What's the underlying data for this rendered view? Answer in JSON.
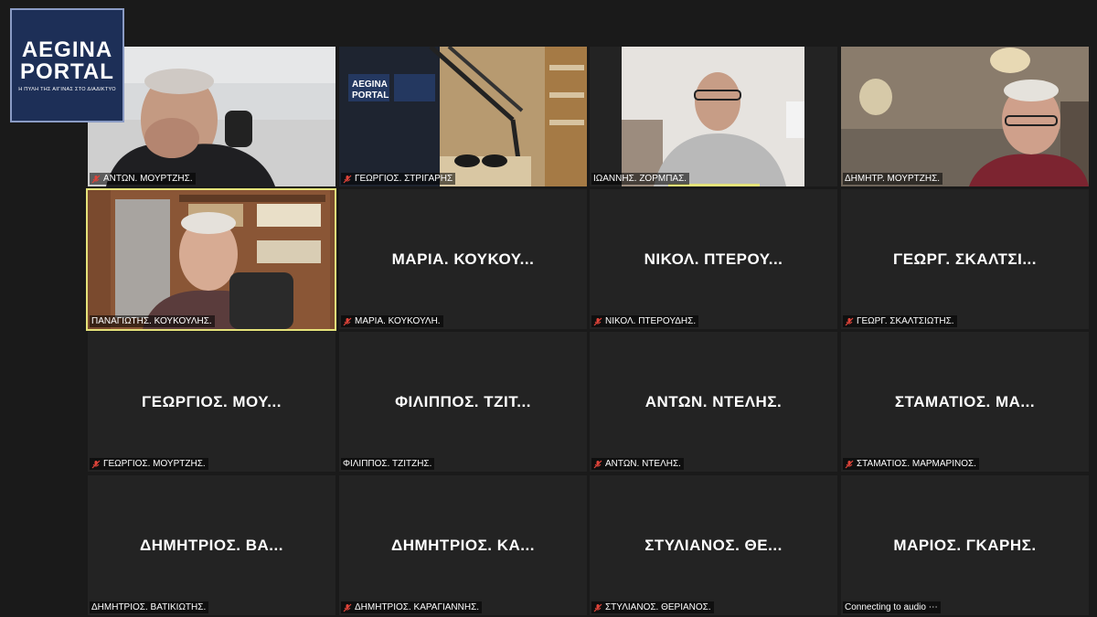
{
  "logo": {
    "line1": "AEGINA",
    "line2": "PORTAL",
    "tagline": "Η ΠΥΛΗ ΤΗΣ ΑΙΓΙΝΑΣ ΣΤΟ ΔΙΑΔΙΚΤΥΟ"
  },
  "colors": {
    "active_border": "#e4e27a",
    "tile_bg": "#232323",
    "muted_red": "#e0443a"
  },
  "participants": [
    {
      "label": "ΑΝΤΩΝ. ΜΟΥΡΤΖΗΣ.",
      "muted": true,
      "video": true
    },
    {
      "label": "ΓΕΩΡΓΙΟΣ. ΣΤΡΙΓΑΡΗΣ",
      "muted": true,
      "video": true
    },
    {
      "label": "ΙΩΑΝΝΗΣ. ΖΟΡΜΠΑΣ.",
      "muted": false,
      "video": true,
      "speaking": true
    },
    {
      "label": "ΔΗΜΗΤΡ. ΜΟΥΡΤΖΗΣ.",
      "muted": false,
      "video": true
    },
    {
      "label": "ΠΑΝΑΓΙΩΤΗΣ. ΚΟΥΚΟΥΛΗΣ.",
      "muted": false,
      "video": true,
      "active": true
    },
    {
      "label": "ΜΑΡΙΑ. ΚΟΥΚΟΥΛΗ.",
      "display": "ΜΑΡΙΑ. ΚΟΥΚΟΥ...",
      "muted": true,
      "video": false
    },
    {
      "label": "ΝΙΚΟΛ. ΠΤΕΡΟΥΔΗΣ.",
      "display": "ΝΙΚΟΛ. ΠΤΕΡΟΥ...",
      "muted": true,
      "video": false
    },
    {
      "label": "ΓΕΩΡΓ. ΣΚΑΛΤΣΙΩΤΗΣ.",
      "display": "ΓΕΩΡΓ. ΣΚΑΛΤΣΙ...",
      "muted": true,
      "video": false
    },
    {
      "label": "ΓΕΩΡΓΙΟΣ. ΜΟΥΡΤΖΗΣ.",
      "display": "ΓΕΩΡΓΙΟΣ. ΜΟΥ...",
      "muted": true,
      "video": false
    },
    {
      "label": "ΦΙΛΙΠΠΟΣ. ΤΖΙΤΖΗΣ.",
      "display": "ΦΙΛΙΠΠΟΣ. ΤΖΙΤ...",
      "muted": false,
      "video": false
    },
    {
      "label": "ΑΝΤΩΝ. ΝΤΕΛΗΣ.",
      "display": "ΑΝΤΩΝ. ΝΤΕΛΗΣ.",
      "muted": true,
      "video": false
    },
    {
      "label": "ΣΤΑΜΑΤΙΟΣ. ΜΑΡΜΑΡΙΝΟΣ.",
      "display": "ΣΤΑΜΑΤΙΟΣ. ΜΑ...",
      "muted": true,
      "video": false
    },
    {
      "label": "ΔΗΜΗΤΡΙΟΣ. ΒΑΤΙΚΙΩΤΗΣ.",
      "display": "ΔΗΜΗΤΡΙΟΣ. ΒΑ...",
      "muted": false,
      "video": false
    },
    {
      "label": "ΔΗΜΗΤΡΙΟΣ. ΚΑΡΑΓΙΑΝΝΗΣ.",
      "display": "ΔΗΜΗΤΡΙΟΣ. ΚΑ...",
      "muted": true,
      "video": false
    },
    {
      "label": "ΣΤΥΛΙΑΝΟΣ. ΘΕΡΙΑΝΟΣ.",
      "display": "ΣΤΥΛΙΑΝΟΣ. ΘΕ...",
      "muted": true,
      "video": false
    },
    {
      "label": "Connecting to audio ⋯",
      "display": "ΜΑΡΙΟΣ. ΓΚΑΡΗΣ.",
      "muted": false,
      "video": false
    }
  ]
}
